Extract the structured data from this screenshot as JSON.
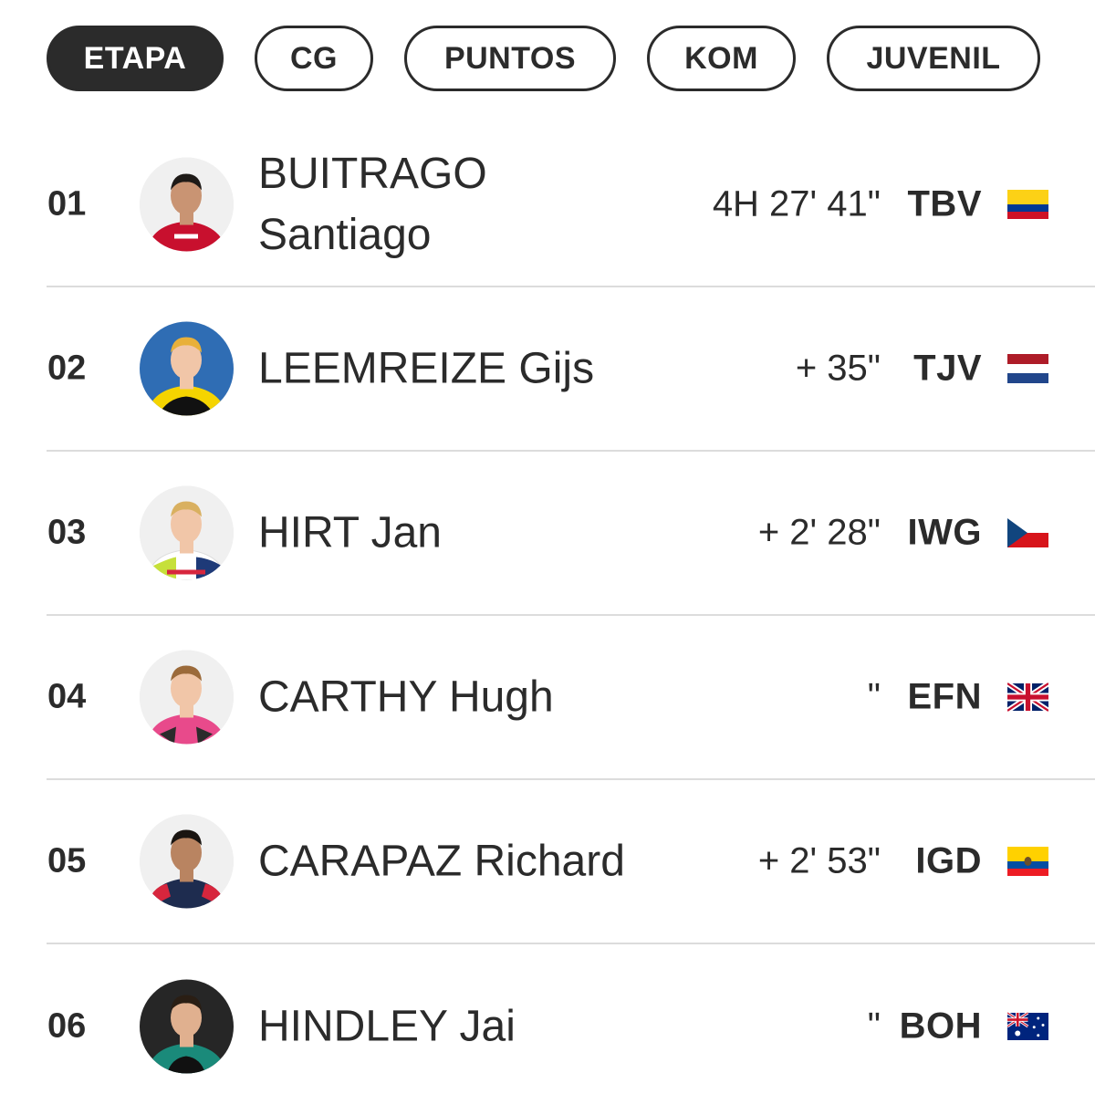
{
  "tabs": [
    "ETAPA",
    "CG",
    "PUNTOS",
    "KOM",
    "JUVENIL"
  ],
  "riders": [
    {
      "pos": "01",
      "name": "BUITRAGO Santiago",
      "time": "4H 27' 41\"",
      "team": "TBV",
      "flag": "colombia-flag",
      "jersey": "#c8102e"
    },
    {
      "pos": "02",
      "name": "LEEMREIZE Gijs",
      "time": "+ 35\"",
      "team": "TJV",
      "flag": "netherlands-flag",
      "jersey": "#f5d400"
    },
    {
      "pos": "03",
      "name": "HIRT Jan",
      "time": "+ 2' 28\"",
      "team": "IWG",
      "flag": "czech-flag",
      "jersey": "#ffffff"
    },
    {
      "pos": "04",
      "name": "CARTHY Hugh",
      "time": "\"",
      "team": "EFN",
      "flag": "uk-flag",
      "jersey": "#e84a8b"
    },
    {
      "pos": "05",
      "name": "CARAPAZ Richard",
      "time": "+ 2' 53\"",
      "team": "IGD",
      "flag": "ecuador-flag",
      "jersey": "#1e2c4f"
    },
    {
      "pos": "06",
      "name": "HINDLEY Jai",
      "time": "\"",
      "team": "BOH",
      "flag": "australia-flag",
      "jersey": "#1a8a7a"
    }
  ]
}
